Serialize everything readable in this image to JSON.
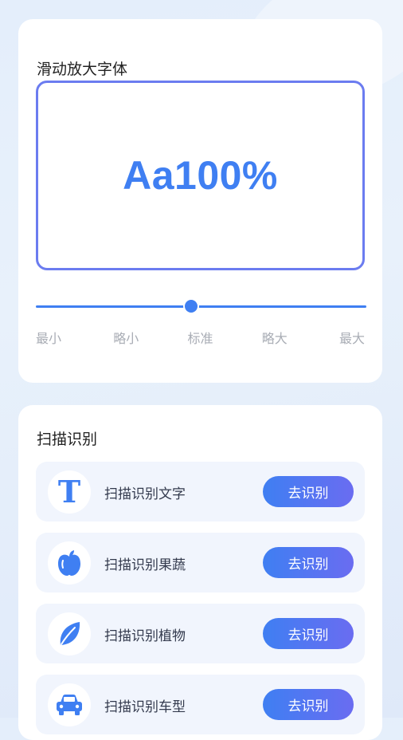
{
  "font_card": {
    "title": "滑动放大字体",
    "preview_text": "Aa100%",
    "slider": {
      "labels": [
        "最小",
        "略小",
        "标准",
        "略大",
        "最大"
      ],
      "selected_index": 2
    }
  },
  "scan_card": {
    "title": "扫描识别",
    "items": [
      {
        "label": "扫描识别文字",
        "button": "去识别",
        "icon": "text-t-icon"
      },
      {
        "label": "扫描识别果蔬",
        "button": "去识别",
        "icon": "apple-icon"
      },
      {
        "label": "扫描识别植物",
        "button": "去识别",
        "icon": "leaf-icon"
      },
      {
        "label": "扫描识别车型",
        "button": "去识别",
        "icon": "car-icon"
      }
    ]
  },
  "colors": {
    "accent": "#3f7ff2",
    "accent_end": "#6a6cf1",
    "preview_border": "#6b7cf0"
  }
}
